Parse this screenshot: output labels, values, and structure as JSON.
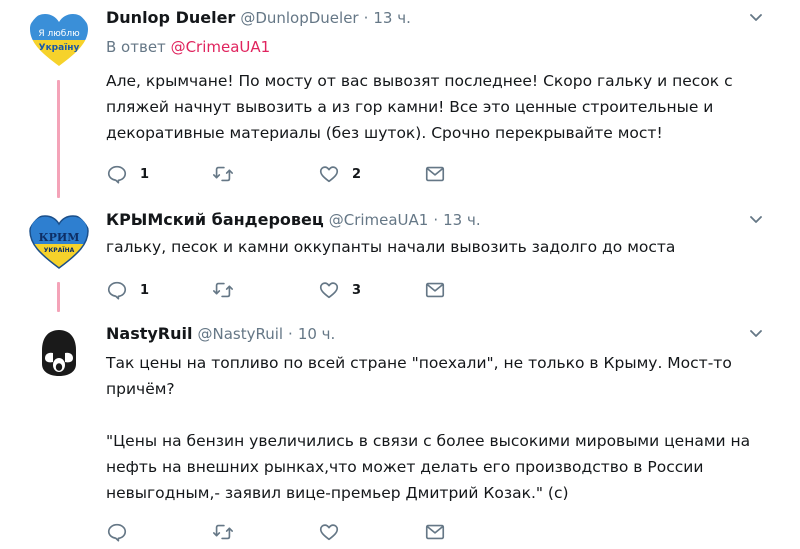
{
  "tweets": [
    {
      "name": "Dunlop Dueler",
      "handle": "@DunlopDueler",
      "separator": "·",
      "time": "13 ч.",
      "avatar_text_1": "Я люблю",
      "avatar_text_2": "Україну",
      "replying_prefix": "В ответ",
      "replying_mention": "@CrimeaUA1",
      "text_paragraphs": [
        "Але, крымчане! По мосту от вас вывозят последнее! Скоро гальку и песок с пляжей начнут вывозить а из гор камни! Все это ценные строительные и декоративные материалы (без шуток). Срочно перекрывайте мост!"
      ],
      "reply_count": "1",
      "retweet_count": "",
      "like_count": "2"
    },
    {
      "name": "КРЫМский бандеровец",
      "handle": "@CrimeaUA1",
      "separator": "·",
      "time": "13 ч.",
      "avatar_text_1": "КРИМ",
      "avatar_text_2": "УКРАЇНА",
      "text_paragraphs": [
        "гальку, песок и камни оккупанты начали вывозить задолго до моста"
      ],
      "reply_count": "1",
      "retweet_count": "",
      "like_count": "3"
    },
    {
      "name": "NastyRuil",
      "handle": "@NastyRuil",
      "separator": "·",
      "time": "10 ч.",
      "text_paragraphs": [
        "Так цены на топливо по всей стране \"поехали\", не только в Крыму. Мост-то причём?",
        "\"Цены на бензин увеличились в связи с более высокими мировыми ценами на  нефть на внешних рынках,что может делать его производство в России невыгодным,- заявил вице-премьер Дмитрий Козак.\" (с)"
      ],
      "reply_count": "",
      "retweet_count": "",
      "like_count": ""
    }
  ],
  "icons": {
    "reply": "reply-icon",
    "retweet": "retweet-icon",
    "like": "heart-icon",
    "dm": "envelope-icon",
    "more": "chevron-down-icon"
  },
  "colors": {
    "text": "#14171a",
    "muted": "#657786",
    "mention": "#e0245e",
    "thread_line": "#f4a3b8",
    "icon": "#657786"
  }
}
